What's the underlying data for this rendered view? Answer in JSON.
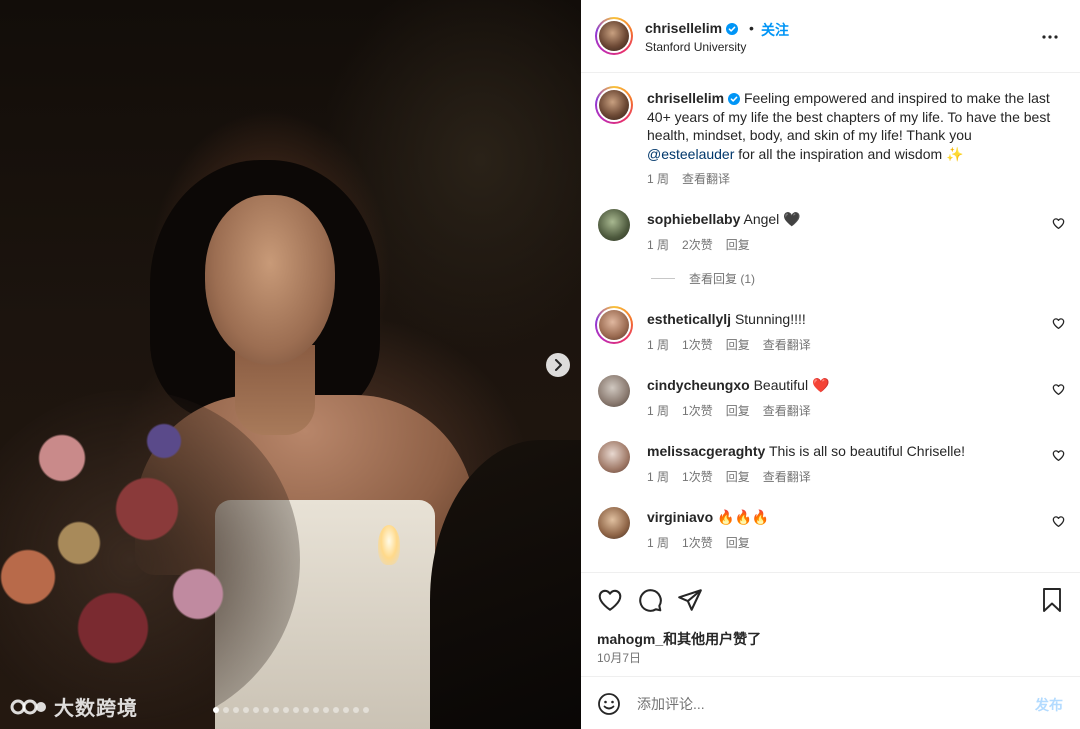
{
  "photo": {
    "carousel_count": 16,
    "carousel_active_index": 0,
    "watermark": "大数跨境"
  },
  "header": {
    "username": "chrisellelim",
    "dot": "•",
    "follow_label": "关注",
    "location": "Stanford University"
  },
  "caption": {
    "username": "chrisellelim",
    "text_before": "Feeling empowered and inspired to make the last 40+ years of my life the best chapters of my life. To have the best health, mindset, body, and skin of my life! Thank you ",
    "mention": "@esteelauder",
    "text_after": " for all the inspiration and wisdom ✨",
    "time": "1 周",
    "translate": "查看翻译"
  },
  "comments": [
    {
      "username": "sophiebellaby",
      "text": "Angel 🖤",
      "time": "1 周",
      "likes": "2次赞",
      "reply": "回复",
      "translate": ""
    },
    {
      "username": "estheticallylj",
      "text": "Stunning!!!!",
      "time": "1 周",
      "likes": "1次赞",
      "reply": "回复",
      "translate": "查看翻译"
    },
    {
      "username": "cindycheungxo",
      "text": "Beautiful ❤️",
      "time": "1 周",
      "likes": "1次赞",
      "reply": "回复",
      "translate": "查看翻译"
    },
    {
      "username": "melissacgeraghty",
      "text": "This is all so beautiful Chriselle!",
      "time": "1 周",
      "likes": "1次赞",
      "reply": "回复",
      "translate": "查看翻译"
    },
    {
      "username": "virginiavo",
      "text": "🔥🔥🔥",
      "time": "1 周",
      "likes": "1次赞",
      "reply": "回复",
      "translate": ""
    }
  ],
  "view_replies": "查看回复 (1)",
  "likes_line": "mahogm_和其他用户赞了",
  "post_date": "10月7日",
  "add_comment": {
    "placeholder": "添加评论...",
    "post_label": "发布"
  },
  "colors": {
    "accent_blue": "#0095f6",
    "verified_blue": "#0095f6",
    "text_primary": "#262626",
    "text_secondary": "#737373"
  },
  "icons": [
    "verified-badge-icon",
    "more-options-icon",
    "heart-icon",
    "comment-icon",
    "share-icon",
    "bookmark-icon",
    "emoji-icon",
    "chevron-right-icon"
  ]
}
